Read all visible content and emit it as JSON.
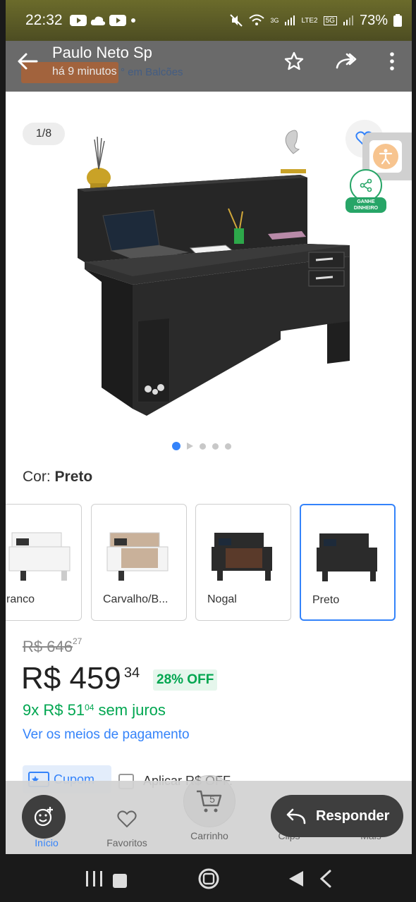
{
  "status_bar": {
    "time": "22:32",
    "network_labels": [
      "3G",
      "LTE2",
      "5G"
    ],
    "battery": "73%"
  },
  "header": {
    "sender": "Paulo Neto Sp",
    "time_ago": "há 9 minutos",
    "underlay_text": "° em Balcões"
  },
  "gallery": {
    "counter": "1/8",
    "share_label": "GANHE DINHEIRO",
    "dot_count": 5,
    "active_dot": 0
  },
  "color": {
    "label": "Cor:",
    "selected": "Preto"
  },
  "variants": [
    {
      "label": "Branco",
      "display": "ranco",
      "body_color": "#f4f4f4",
      "front_color": "#f4f4f4"
    },
    {
      "label": "Carvalho/B...",
      "display": "Carvalho/B...",
      "body_color": "#f4f4f4",
      "front_color": "#c9b19a"
    },
    {
      "label": "Nogal",
      "display": "Nogal",
      "body_color": "#2b2b2b",
      "front_color": "#5a3a2a"
    },
    {
      "label": "Preto",
      "display": "Preto",
      "body_color": "#2b2b2b",
      "front_color": "#2b2b2b",
      "selected": true
    }
  ],
  "pricing": {
    "old_price": "R$ 646",
    "old_cents": "27",
    "price": "R$ 459",
    "price_cents": "34",
    "discount": "28% OFF",
    "installments_prefix": "9x R$ 51",
    "installments_cents": "04",
    "installments_suffix": " sem juros",
    "payment_link": "Ver os meios de pagamento"
  },
  "coupon": {
    "button": "Cupom",
    "apply_text": "Aplicar R$    OFF."
  },
  "bottom_nav": {
    "items": [
      "Início",
      "Favoritos",
      "Carrinho",
      "Clips",
      "Mais"
    ],
    "cart_count": "5",
    "reply": "Responder"
  },
  "colors": {
    "accent_blue": "#3483fa",
    "green": "#00a650",
    "share_green": "#27a567"
  }
}
